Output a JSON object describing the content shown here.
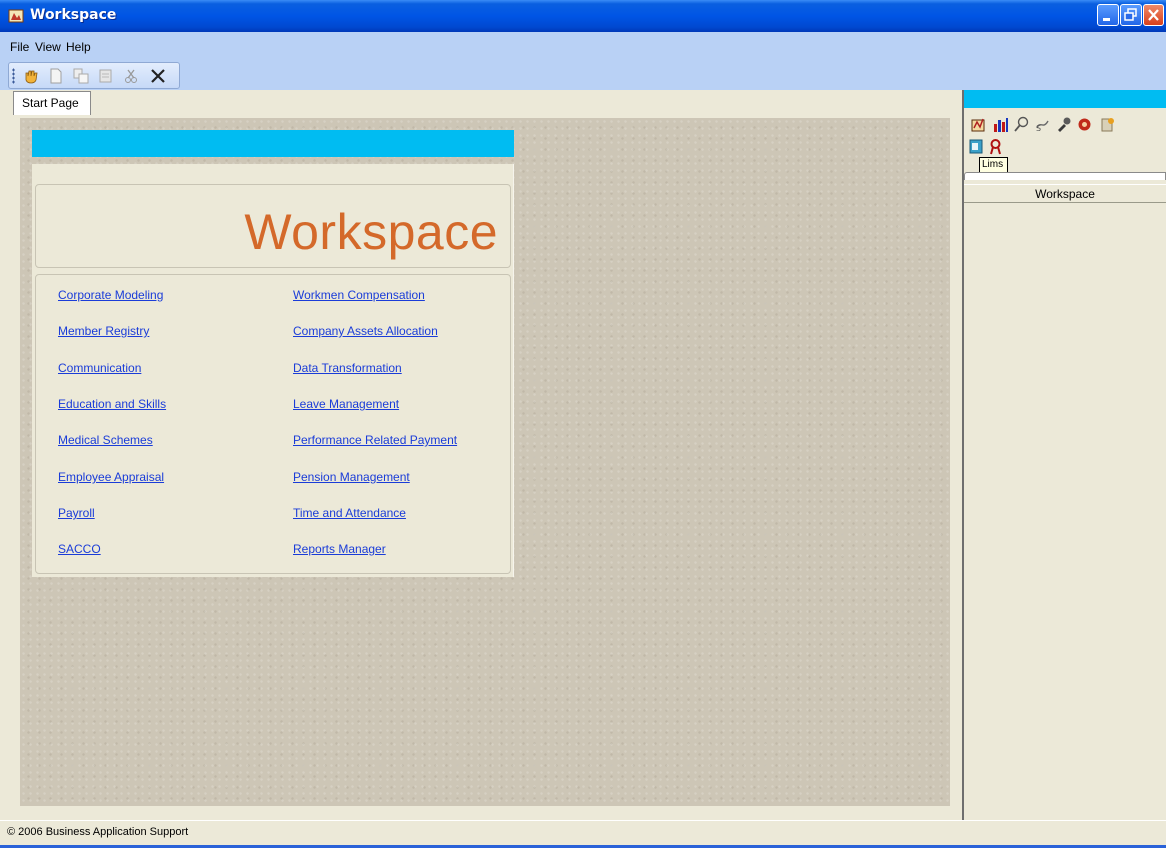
{
  "window": {
    "title": "Workspace",
    "icon": "app-icon",
    "buttons": [
      "minimize-icon",
      "restore-icon",
      "close-icon"
    ]
  },
  "menu": {
    "file": "File",
    "view": "View",
    "help": "Help"
  },
  "toolbar": {
    "items": [
      "grab-hand-icon",
      "new-document-icon",
      "copy-icon",
      "edit-icon",
      "cut-icon",
      "delete-icon"
    ]
  },
  "tabs": {
    "start_page": "Start Page"
  },
  "start_page": {
    "logo_text": "Workspace",
    "links_left": [
      "Corporate Modeling",
      "Member Registry",
      "Communication",
      "Education and Skills",
      "Medical Schemes",
      "Employee Appraisal",
      "Payroll",
      "SACCO"
    ],
    "links_right": [
      "Workmen Compensation",
      "Company Assets Allocation",
      "Data Transformation",
      "Leave Management",
      "Performance Related Payment",
      "Pension Management",
      "Time and Attendance",
      "Reports Manager"
    ]
  },
  "dock": {
    "icons": [
      "module-icon-1",
      "chart-icon",
      "search-icon",
      "module-icon-4",
      "tools-icon",
      "settings-icon",
      "help-icon",
      "lims-icon",
      "ribbon-icon"
    ],
    "tooltip": "Lims",
    "header": "Workspace"
  },
  "status": {
    "text": "© 2006 Business Application Support"
  },
  "colors": {
    "titlebar": "#0055e5",
    "menubar": "#b9d1f5",
    "accent_cyan": "#00bcf2",
    "logo": "#d4692a",
    "link": "#1a3cd8"
  }
}
